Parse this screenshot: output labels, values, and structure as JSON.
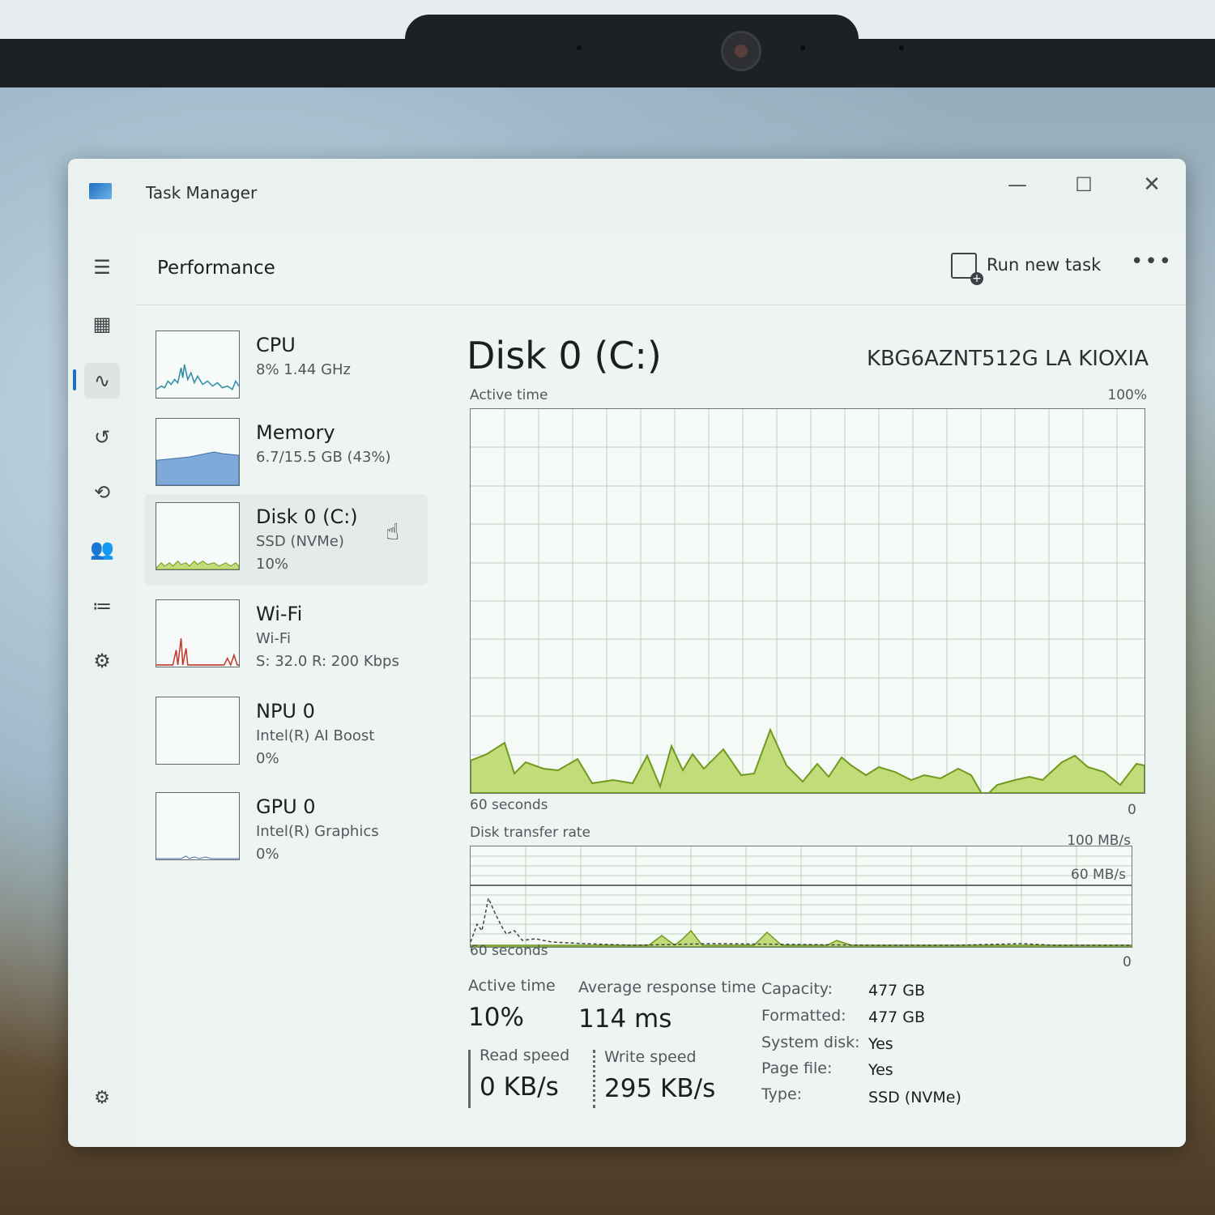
{
  "window": {
    "title": "Task Manager",
    "controls": {
      "minimize": "—",
      "maximize": "☐",
      "close": "✕"
    }
  },
  "rail": [
    {
      "name": "menu",
      "glyph": "☰"
    },
    {
      "name": "processes",
      "glyph": "▦"
    },
    {
      "name": "performance",
      "glyph": "∿",
      "active": true
    },
    {
      "name": "app-history",
      "glyph": "↺"
    },
    {
      "name": "startup-apps",
      "glyph": "⟲"
    },
    {
      "name": "users",
      "glyph": "👥"
    },
    {
      "name": "details",
      "glyph": "≔"
    },
    {
      "name": "services",
      "glyph": "⚙"
    }
  ],
  "settings_glyph": "⚙",
  "header": {
    "title": "Performance",
    "run_new_task": "Run new task",
    "more": "•••"
  },
  "devices": [
    {
      "name": "CPU",
      "line1": "8%  1.44 GHz",
      "line2": ""
    },
    {
      "name": "Memory",
      "line1": "6.7/15.5 GB (43%)",
      "line2": ""
    },
    {
      "name": "Disk 0 (C:)",
      "line1": "SSD (NVMe)",
      "line2": "10%",
      "selected": true
    },
    {
      "name": "Wi-Fi",
      "line1": "Wi-Fi",
      "line2": "S: 32.0  R: 200 Kbps"
    },
    {
      "name": "NPU 0",
      "line1": "Intel(R) AI Boost",
      "line2": "0%"
    },
    {
      "name": "GPU 0",
      "line1": "Intel(R) Graphics",
      "line2": "0%"
    }
  ],
  "detail": {
    "title": "Disk 0 (C:)",
    "model": "KBG6AZNT512G LA KIOXIA",
    "active_time_graph": {
      "label": "Active time",
      "max_label": "100%",
      "time_label": "60 seconds",
      "min_label": "0"
    },
    "transfer_graph": {
      "label": "Disk transfer rate",
      "max_label": "100 MB/s",
      "mid_label": "60 MB/s",
      "time_label": "60 seconds",
      "min_label": "0"
    },
    "stats": {
      "active_time_label": "Active time",
      "active_time_value": "10%",
      "avg_response_label": "Average response time",
      "avg_response_value": "114 ms",
      "read_speed_label": "Read speed",
      "read_speed_value": "0 KB/s",
      "write_speed_label": "Write speed",
      "write_speed_value": "295 KB/s"
    },
    "properties": [
      {
        "key": "Capacity:",
        "value": "477 GB"
      },
      {
        "key": "Formatted:",
        "value": "477 GB"
      },
      {
        "key": "System disk:",
        "value": "Yes"
      },
      {
        "key": "Page file:",
        "value": "Yes"
      },
      {
        "key": "Type:",
        "value": "SSD (NVMe)"
      }
    ]
  },
  "colors": {
    "disk_fill": "#c3dc7a",
    "disk_line": "#6f9a1e",
    "cpu_line": "#2f8ea8",
    "memory_fill": "#7fa9d8",
    "wifi_line": "#c0392b"
  }
}
